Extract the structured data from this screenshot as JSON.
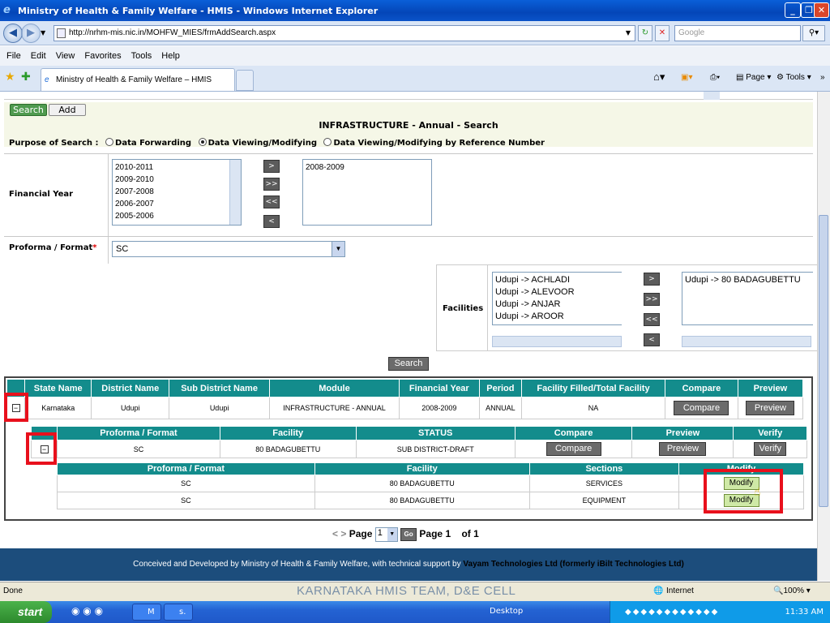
{
  "window": {
    "title": "Ministry of Health & Family Welfare - HMIS - Windows Internet Explorer"
  },
  "addressbar": {
    "url": "http://nrhm-mis.nic.in/MOHFW_MIES/frmAddSearch.aspx",
    "search_placeholder": "Google"
  },
  "menu": [
    "File",
    "Edit",
    "View",
    "Favorites",
    "Tools",
    "Help"
  ],
  "tab": {
    "label": "Ministry of Health & Family Welfare – HMIS"
  },
  "toolbar": {
    "page_label": "Page",
    "tools_label": "Tools"
  },
  "form": {
    "search_tab": "Search",
    "add_tab": "Add",
    "title": "INFRASTRUCTURE - Annual - Search",
    "purpose_label": "Purpose of Search :",
    "purpose_options": [
      "Data Forwarding",
      "Data Viewing/Modifying",
      "Data Viewing/Modifying by Reference Number"
    ],
    "purpose_selected": 1,
    "financial_year_label": "Financial Year",
    "years_available": [
      "2010-2011",
      "2009-2010",
      "2007-2008",
      "2006-2007",
      "2005-2006"
    ],
    "years_selected": [
      "2008-2009"
    ],
    "proforma_label": "Proforma / Format",
    "proforma_required": "*",
    "proforma_value": "SC",
    "facilities_label": "Facilities",
    "facilities_available": [
      "Udupi -> ACHLADI",
      "Udupi -> ALEVOOR",
      "Udupi -> ANJAR",
      "Udupi -> AROOR"
    ],
    "facilities_selected": [
      "Udupi -> 80 BADAGUBETTU"
    ],
    "arrow_buttons": [
      ">",
      ">>",
      "<<",
      "<"
    ],
    "search_button": "Search"
  },
  "main_grid": {
    "headers": [
      "State Name",
      "District Name",
      "Sub District Name",
      "Module",
      "Financial Year",
      "Period",
      "Facility Filled/Total Facility",
      "Compare",
      "Preview"
    ],
    "row": {
      "toggle": "−",
      "state": "Karnataka",
      "district": "Udupi",
      "sub_district": "Udupi",
      "module": "INFRASTRUCTURE - ANNUAL",
      "financial_year": "2008-2009",
      "period": "ANNUAL",
      "filled": "NA",
      "compare": "Compare",
      "preview": "Preview"
    }
  },
  "sub_grid": {
    "headers": [
      "Proforma / Format",
      "Facility",
      "STATUS",
      "Compare",
      "Preview",
      "Verify"
    ],
    "row": {
      "toggle": "−",
      "proforma": "SC",
      "facility": "80 BADAGUBETTU",
      "status": "SUB DISTRICT-DRAFT",
      "compare": "Compare",
      "preview": "Preview",
      "verify": "Verify"
    }
  },
  "sections_grid": {
    "headers": [
      "Proforma / Format",
      "Facility",
      "Sections",
      "Modify"
    ],
    "rows": [
      {
        "proforma": "SC",
        "facility": "80 BADAGUBETTU",
        "section": "SERVICES",
        "action": "Modify"
      },
      {
        "proforma": "SC",
        "facility": "80 BADAGUBETTU",
        "section": "EQUIPMENT",
        "action": "Modify"
      }
    ]
  },
  "pager": {
    "prev_next": "< >",
    "page_label": "Page",
    "page_value": "1",
    "go": "Go",
    "page_text": "Page 1",
    "of_text": "of 1"
  },
  "footer": {
    "text": "Conceived and Developed by Ministry of Health & Family Welfare, with technical support by",
    "company": "Vayam Technologies Ltd (formerly iBilt Technologies Ltd)"
  },
  "statusbar": {
    "status": "Done",
    "watermark": "KARNATAKA HMIS TEAM, D&E CELL",
    "zone": "Internet",
    "zoom": "100%"
  },
  "taskbar": {
    "start": "start",
    "tasks": [
      "M",
      "s."
    ],
    "desktop": "Desktop",
    "clock": "11:33 AM"
  },
  "colors": {
    "grid_header": "#138c8c",
    "highlight_box": "#e8101c",
    "footer_bg": "#1c4d7c"
  }
}
